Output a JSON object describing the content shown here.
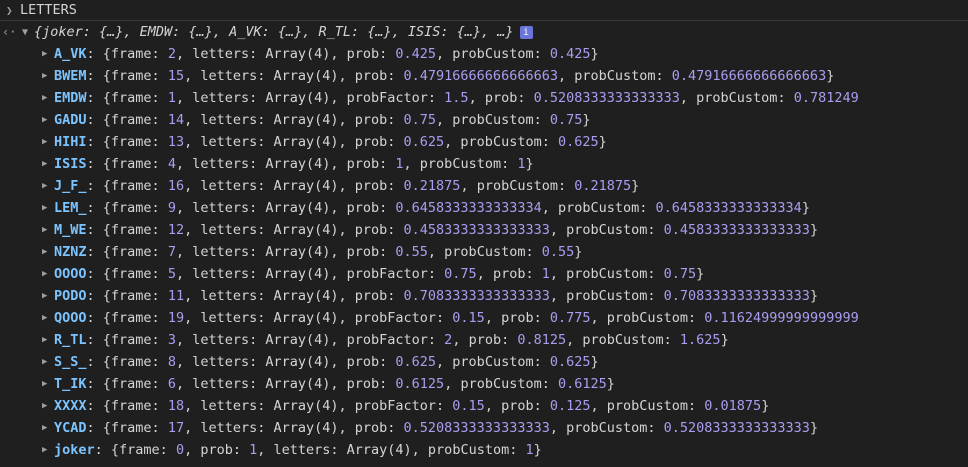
{
  "header": {
    "title": "LETTERS"
  },
  "summary": {
    "text": "{joker: {…}, EMDW: {…}, A_VK: {…}, R_TL: {…}, ISIS: {…}, …}",
    "info": "i"
  },
  "rows": [
    {
      "key": "A_VK",
      "parts": [
        [
          "t",
          "{frame: "
        ],
        [
          "n",
          "2"
        ],
        [
          "t",
          ", letters: Array(4), prob: "
        ],
        [
          "n",
          "0.425"
        ],
        [
          "t",
          ", probCustom: "
        ],
        [
          "n",
          "0.425"
        ],
        [
          "t",
          "}"
        ]
      ]
    },
    {
      "key": "BWEM",
      "parts": [
        [
          "t",
          "{frame: "
        ],
        [
          "n",
          "15"
        ],
        [
          "t",
          ", letters: Array(4), prob: "
        ],
        [
          "n",
          "0.47916666666666663"
        ],
        [
          "t",
          ", probCustom: "
        ],
        [
          "n",
          "0.47916666666666663"
        ],
        [
          "t",
          "}"
        ]
      ]
    },
    {
      "key": "EMDW",
      "parts": [
        [
          "t",
          "{frame: "
        ],
        [
          "n",
          "1"
        ],
        [
          "t",
          ", letters: Array(4), probFactor: "
        ],
        [
          "n",
          "1.5"
        ],
        [
          "t",
          ", prob: "
        ],
        [
          "n",
          "0.5208333333333333"
        ],
        [
          "t",
          ", probCustom: "
        ],
        [
          "n",
          "0.781249"
        ]
      ]
    },
    {
      "key": "GADU",
      "parts": [
        [
          "t",
          "{frame: "
        ],
        [
          "n",
          "14"
        ],
        [
          "t",
          ", letters: Array(4), prob: "
        ],
        [
          "n",
          "0.75"
        ],
        [
          "t",
          ", probCustom: "
        ],
        [
          "n",
          "0.75"
        ],
        [
          "t",
          "}"
        ]
      ]
    },
    {
      "key": "HIHI",
      "parts": [
        [
          "t",
          "{frame: "
        ],
        [
          "n",
          "13"
        ],
        [
          "t",
          ", letters: Array(4), prob: "
        ],
        [
          "n",
          "0.625"
        ],
        [
          "t",
          ", probCustom: "
        ],
        [
          "n",
          "0.625"
        ],
        [
          "t",
          "}"
        ]
      ]
    },
    {
      "key": "ISIS",
      "parts": [
        [
          "t",
          "{frame: "
        ],
        [
          "n",
          "4"
        ],
        [
          "t",
          ", letters: Array(4), prob: "
        ],
        [
          "n",
          "1"
        ],
        [
          "t",
          ", probCustom: "
        ],
        [
          "n",
          "1"
        ],
        [
          "t",
          "}"
        ]
      ]
    },
    {
      "key": "J_F_",
      "parts": [
        [
          "t",
          "{frame: "
        ],
        [
          "n",
          "16"
        ],
        [
          "t",
          ", letters: Array(4), prob: "
        ],
        [
          "n",
          "0.21875"
        ],
        [
          "t",
          ", probCustom: "
        ],
        [
          "n",
          "0.21875"
        ],
        [
          "t",
          "}"
        ]
      ]
    },
    {
      "key": "LEM_",
      "parts": [
        [
          "t",
          "{frame: "
        ],
        [
          "n",
          "9"
        ],
        [
          "t",
          ", letters: Array(4), prob: "
        ],
        [
          "n",
          "0.6458333333333334"
        ],
        [
          "t",
          ", probCustom: "
        ],
        [
          "n",
          "0.6458333333333334"
        ],
        [
          "t",
          "}"
        ]
      ]
    },
    {
      "key": "M_WE",
      "parts": [
        [
          "t",
          "{frame: "
        ],
        [
          "n",
          "12"
        ],
        [
          "t",
          ", letters: Array(4), prob: "
        ],
        [
          "n",
          "0.4583333333333333"
        ],
        [
          "t",
          ", probCustom: "
        ],
        [
          "n",
          "0.4583333333333333"
        ],
        [
          "t",
          "}"
        ]
      ]
    },
    {
      "key": "NZNZ",
      "parts": [
        [
          "t",
          "{frame: "
        ],
        [
          "n",
          "7"
        ],
        [
          "t",
          ", letters: Array(4), prob: "
        ],
        [
          "n",
          "0.55"
        ],
        [
          "t",
          ", probCustom: "
        ],
        [
          "n",
          "0.55"
        ],
        [
          "t",
          "}"
        ]
      ]
    },
    {
      "key": "OOOO",
      "parts": [
        [
          "t",
          "{frame: "
        ],
        [
          "n",
          "5"
        ],
        [
          "t",
          ", letters: Array(4), probFactor: "
        ],
        [
          "n",
          "0.75"
        ],
        [
          "t",
          ", prob: "
        ],
        [
          "n",
          "1"
        ],
        [
          "t",
          ", probCustom: "
        ],
        [
          "n",
          "0.75"
        ],
        [
          "t",
          "}"
        ]
      ]
    },
    {
      "key": "PODO",
      "parts": [
        [
          "t",
          "{frame: "
        ],
        [
          "n",
          "11"
        ],
        [
          "t",
          ", letters: Array(4), prob: "
        ],
        [
          "n",
          "0.7083333333333333"
        ],
        [
          "t",
          ", probCustom: "
        ],
        [
          "n",
          "0.7083333333333333"
        ],
        [
          "t",
          "}"
        ]
      ]
    },
    {
      "key": "QOOO",
      "parts": [
        [
          "t",
          "{frame: "
        ],
        [
          "n",
          "19"
        ],
        [
          "t",
          ", letters: Array(4), probFactor: "
        ],
        [
          "n",
          "0.15"
        ],
        [
          "t",
          ", prob: "
        ],
        [
          "n",
          "0.775"
        ],
        [
          "t",
          ", probCustom: "
        ],
        [
          "n",
          "0.11624999999999999"
        ]
      ]
    },
    {
      "key": "R_TL",
      "parts": [
        [
          "t",
          "{frame: "
        ],
        [
          "n",
          "3"
        ],
        [
          "t",
          ", letters: Array(4), probFactor: "
        ],
        [
          "n",
          "2"
        ],
        [
          "t",
          ", prob: "
        ],
        [
          "n",
          "0.8125"
        ],
        [
          "t",
          ", probCustom: "
        ],
        [
          "n",
          "1.625"
        ],
        [
          "t",
          "}"
        ]
      ]
    },
    {
      "key": "S_S_",
      "parts": [
        [
          "t",
          "{frame: "
        ],
        [
          "n",
          "8"
        ],
        [
          "t",
          ", letters: Array(4), prob: "
        ],
        [
          "n",
          "0.625"
        ],
        [
          "t",
          ", probCustom: "
        ],
        [
          "n",
          "0.625"
        ],
        [
          "t",
          "}"
        ]
      ]
    },
    {
      "key": "T_IK",
      "parts": [
        [
          "t",
          "{frame: "
        ],
        [
          "n",
          "6"
        ],
        [
          "t",
          ", letters: Array(4), prob: "
        ],
        [
          "n",
          "0.6125"
        ],
        [
          "t",
          ", probCustom: "
        ],
        [
          "n",
          "0.6125"
        ],
        [
          "t",
          "}"
        ]
      ]
    },
    {
      "key": "XXXX",
      "parts": [
        [
          "t",
          "{frame: "
        ],
        [
          "n",
          "18"
        ],
        [
          "t",
          ", letters: Array(4), probFactor: "
        ],
        [
          "n",
          "0.15"
        ],
        [
          "t",
          ", prob: "
        ],
        [
          "n",
          "0.125"
        ],
        [
          "t",
          ", probCustom: "
        ],
        [
          "n",
          "0.01875"
        ],
        [
          "t",
          "}"
        ]
      ]
    },
    {
      "key": "YCAD",
      "parts": [
        [
          "t",
          "{frame: "
        ],
        [
          "n",
          "17"
        ],
        [
          "t",
          ", letters: Array(4), prob: "
        ],
        [
          "n",
          "0.5208333333333333"
        ],
        [
          "t",
          ", probCustom: "
        ],
        [
          "n",
          "0.5208333333333333"
        ],
        [
          "t",
          "}"
        ]
      ]
    },
    {
      "key": "joker",
      "parts": [
        [
          "t",
          "{frame: "
        ],
        [
          "n",
          "0"
        ],
        [
          "t",
          ", prob: "
        ],
        [
          "n",
          "1"
        ],
        [
          "t",
          ", letters: Array(4), probCustom: "
        ],
        [
          "n",
          "1"
        ],
        [
          "t",
          "}"
        ]
      ]
    }
  ]
}
